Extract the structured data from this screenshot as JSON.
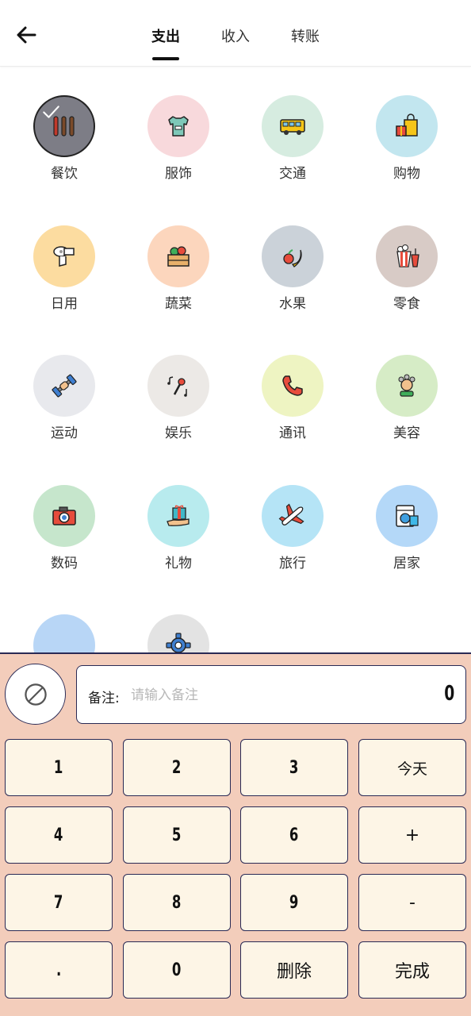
{
  "header": {
    "tabs": [
      {
        "label": "支出",
        "active": true
      },
      {
        "label": "收入",
        "active": false
      },
      {
        "label": "转账",
        "active": false
      }
    ]
  },
  "categories": [
    {
      "label": "餐饮",
      "icon": "utensils-icon",
      "color": "#7d7d86",
      "selected": true
    },
    {
      "label": "服饰",
      "icon": "shirt-icon",
      "color": "#f8d9dc"
    },
    {
      "label": "交通",
      "icon": "bus-icon",
      "color": "#d6ece0"
    },
    {
      "label": "购物",
      "icon": "shopping-bag-icon",
      "color": "#c2e6ef"
    },
    {
      "label": "日用",
      "icon": "toilet-paper-icon",
      "color": "#fcdca0"
    },
    {
      "label": "蔬菜",
      "icon": "vegetable-crate-icon",
      "color": "#fcd6bd"
    },
    {
      "label": "水果",
      "icon": "fruit-icon",
      "color": "#cbd2d9"
    },
    {
      "label": "零食",
      "icon": "popcorn-icon",
      "color": "#d8cbc6"
    },
    {
      "label": "运动",
      "icon": "dumbbell-icon",
      "color": "#e8e9ed"
    },
    {
      "label": "娱乐",
      "icon": "microphone-icon",
      "color": "#ece9e6"
    },
    {
      "label": "通讯",
      "icon": "phone-icon",
      "color": "#eef4c2"
    },
    {
      "label": "美容",
      "icon": "hair-curlers-icon",
      "color": "#d6ecc6"
    },
    {
      "label": "数码",
      "icon": "camera-icon",
      "color": "#c6e6cc"
    },
    {
      "label": "礼物",
      "icon": "gift-icon",
      "color": "#b8ebee"
    },
    {
      "label": "旅行",
      "icon": "airplane-icon",
      "color": "#b5e4f6"
    },
    {
      "label": "居家",
      "icon": "washing-machine-icon",
      "color": "#b4d8f8"
    },
    {
      "label": "",
      "icon": "blank-icon",
      "color": "#b8d6f6"
    },
    {
      "label": "",
      "icon": "gear-icon",
      "color": "#e3e3e3"
    }
  ],
  "note": {
    "label": "备注:",
    "placeholder": "请输入备注",
    "amount": "0"
  },
  "keypad": [
    [
      "1",
      "2",
      "3",
      "今天"
    ],
    [
      "4",
      "5",
      "6",
      "+"
    ],
    [
      "7",
      "8",
      "9",
      "-"
    ],
    [
      ".",
      "0",
      "删除",
      "完成"
    ]
  ],
  "colors": {
    "pad_bg": "#f3cdbb",
    "key_bg": "#fdf5e6",
    "border": "#2a2a55"
  }
}
